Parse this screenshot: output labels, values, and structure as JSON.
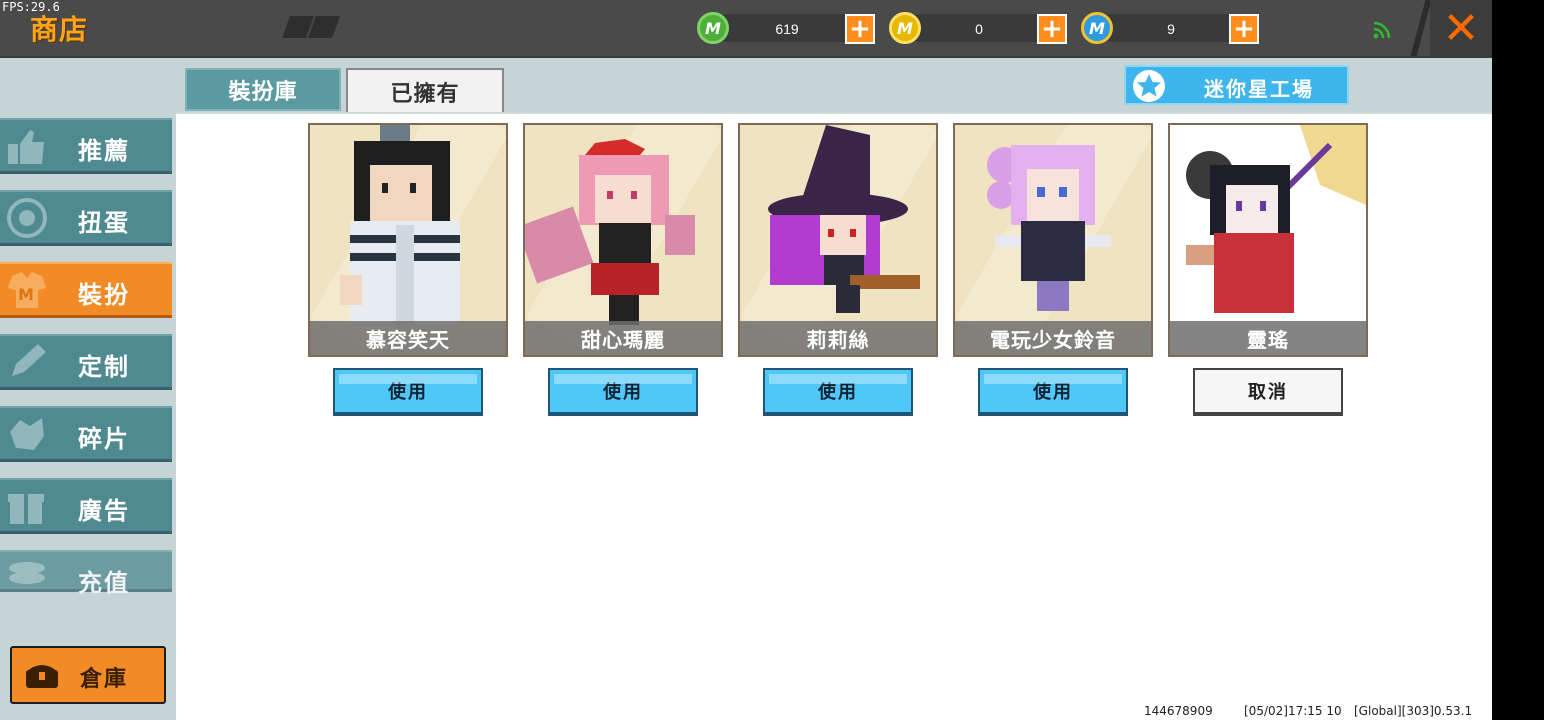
{
  "fps": "FPS:29.6",
  "header": {
    "title": "商店",
    "currencies": [
      {
        "icon": "green-gem-coin-icon",
        "value": "619",
        "color": "#4fae3a"
      },
      {
        "icon": "gold-mini-coin-icon",
        "value": "0",
        "color": "#e6b800"
      },
      {
        "icon": "blue-mini-coin-icon",
        "value": "9",
        "color": "#2e9be0"
      }
    ],
    "add_symbol": "+",
    "close_symbol": "✕"
  },
  "sidebar": {
    "items": [
      {
        "label": "推薦",
        "icon": "thumbs-up-icon"
      },
      {
        "label": "扭蛋",
        "icon": "gacha-icon"
      },
      {
        "label": "裝扮",
        "icon": "outfit-icon"
      },
      {
        "label": "定制",
        "icon": "pencil-icon"
      },
      {
        "label": "碎片",
        "icon": "fragment-icon"
      },
      {
        "label": "廣告",
        "icon": "gift-icon"
      },
      {
        "label": "充值",
        "icon": "coins-icon"
      }
    ],
    "warehouse_label": "倉庫"
  },
  "tabs": [
    {
      "label": "裝扮庫"
    },
    {
      "label": "已擁有"
    }
  ],
  "workshop_label": "迷你星工場",
  "cards": [
    {
      "name": "慕容笑天",
      "button": "使用"
    },
    {
      "name": "甜心瑪麗",
      "button": "使用"
    },
    {
      "name": "莉莉絲",
      "button": "使用"
    },
    {
      "name": "電玩少女鈴音",
      "button": "使用"
    },
    {
      "name": "靈瑤",
      "button": "取消"
    }
  ],
  "footer": {
    "uid": "144678909",
    "time": "[05/02]17:15 10",
    "version": "[Global][303]0.53.1"
  }
}
